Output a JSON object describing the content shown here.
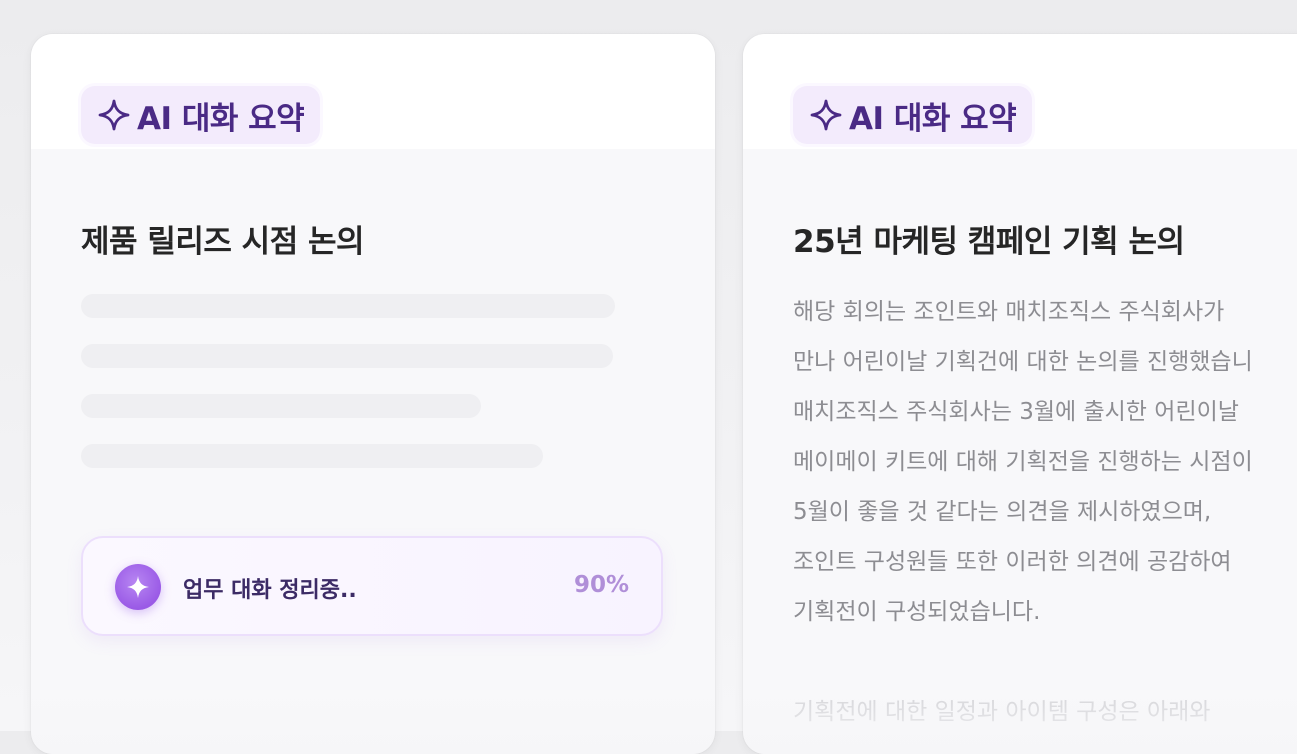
{
  "left_card": {
    "badge_label": "AI 대화 요약",
    "badge_icon": "sparkle-icon",
    "title": "제품 릴리즈 시점 논의",
    "progress": {
      "label": "업무 대화 정리중..",
      "value": "90%",
      "fraction": 0.9,
      "icon": "sparkle-icon"
    }
  },
  "right_card": {
    "badge_label": "AI 대화 요약",
    "badge_icon": "sparkle-icon",
    "title": "25년 마케팅 캠페인 기획 논의",
    "summary_lines": [
      "해당 회의는 조인트와 매치조직스 주식회사가",
      "만나 어린이날 기획건에 대한 논의를 진행했습니",
      "매치조직스 주식회사는 3월에 출시한 어린이날",
      "메이메이 키트에 대해 기획전을 진행하는 시점이",
      "5월이 좋을 것 같다는 의견을 제시하였으며,",
      "조인트 구성원들 또한 이러한 의견에 공감하여",
      "기획전이 구성되었습니다."
    ],
    "summary_faded": "기획전에 대한 일정과 아이템 구성은 아래와"
  },
  "colors": {
    "accent": "#9a5ae6",
    "badge_bg": "#f3ebfc",
    "badge_text": "#4a2a85"
  }
}
